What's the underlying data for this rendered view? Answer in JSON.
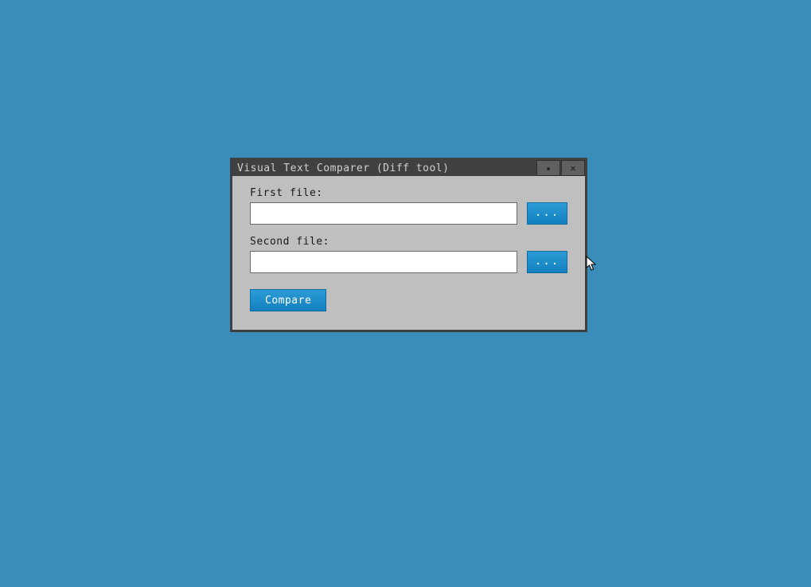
{
  "window": {
    "title": "Visual Text Comparer (Diff tool)"
  },
  "form": {
    "first_file": {
      "label": "First file:",
      "value": "",
      "browse_label": "..."
    },
    "second_file": {
      "label": "Second file:",
      "value": "",
      "browse_label": "..."
    },
    "compare_label": "Compare"
  },
  "icons": {
    "minimize": "▪",
    "close": "✕"
  }
}
